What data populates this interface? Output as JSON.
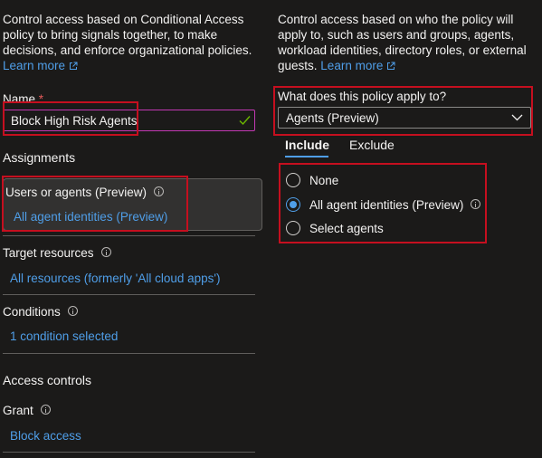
{
  "left": {
    "intro_lines": [
      "Control access based on Conditional Access",
      "policy to bring signals together, to make",
      "decisions, and enforce organizational policies."
    ],
    "learn_more": "Learn more",
    "name_label": "Name",
    "required_mark": "*",
    "name_value": "Block High Risk Agents",
    "assignments_heading": "Assignments",
    "users_label": "Users or agents (Preview)",
    "users_value": "All agent identities (Preview)",
    "target_label": "Target resources",
    "target_value": "All resources (formerly 'All cloud apps')",
    "conditions_label": "Conditions",
    "conditions_value": "1 condition selected",
    "access_controls_heading": "Access controls",
    "grant_label": "Grant",
    "grant_value": "Block access"
  },
  "right": {
    "intro_lines": [
      "Control access based on who the policy will",
      "apply to, such as users and groups, agents,",
      "workload identities, directory roles, or external",
      "guests."
    ],
    "learn_more": "Learn more",
    "applies_label": "What does this policy apply to?",
    "applies_value": "Agents (Preview)",
    "tabs": [
      "Include",
      "Exclude"
    ],
    "options": [
      {
        "label": "None",
        "checked": false
      },
      {
        "label": "All agent identities (Preview)",
        "checked": true
      },
      {
        "label": "Select agents",
        "checked": false
      }
    ]
  },
  "colors": {
    "background": "#1b1a19",
    "link": "#4f9ee8",
    "annotation_red": "#c50f1f",
    "input_focus_border": "#c239b3",
    "valid_check": "#6bb700"
  }
}
